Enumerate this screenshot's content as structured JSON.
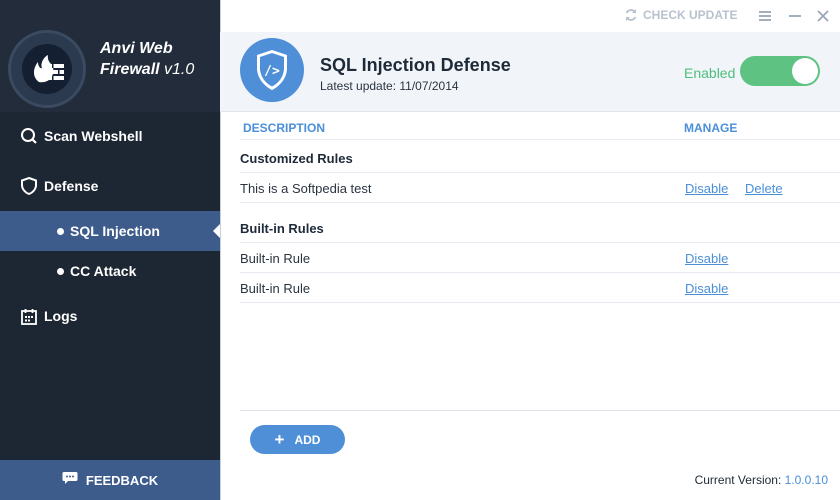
{
  "app": {
    "name": "Anvi Web Firewall",
    "version": "v1.0"
  },
  "sidebar": {
    "items": [
      {
        "label": "Scan Webshell",
        "icon": "search-icon"
      },
      {
        "label": "Defense",
        "icon": "shield-icon"
      },
      {
        "label": "SQL Injection",
        "icon": "bullet"
      },
      {
        "label": "CC Attack",
        "icon": "bullet"
      },
      {
        "label": "Logs",
        "icon": "calendar-icon"
      }
    ],
    "active": "SQL Injection",
    "feedback_label": "FEEDBACK"
  },
  "topbar": {
    "check_update_label": "CHECK UPDATE"
  },
  "header": {
    "title": "SQL Injection Defense",
    "subtitle": "Latest update: 11/07/2014",
    "toggle_label": "Enabled",
    "toggle_on": true
  },
  "table": {
    "col_description": "DESCRIPTION",
    "col_manage": "MANAGE",
    "sections": [
      {
        "title": "Customized Rules",
        "rows": [
          {
            "name": "This is a Softpedia test",
            "actions": [
              "Disable",
              "Delete"
            ]
          }
        ]
      },
      {
        "title": "Built-in Rules",
        "rows": [
          {
            "name": "Built-in Rule",
            "actions": [
              "Disable"
            ]
          },
          {
            "name": "Built-in Rule",
            "actions": [
              "Disable"
            ]
          }
        ]
      }
    ]
  },
  "footer": {
    "add_label": "ADD",
    "version_prefix": "Current Version: ",
    "version": "1.0.0.10"
  },
  "colors": {
    "sidebar_bg": "#1d2633",
    "accent": "#4e8fd8",
    "active_nav": "#3d5c8c",
    "enabled_green": "#5ec283"
  }
}
